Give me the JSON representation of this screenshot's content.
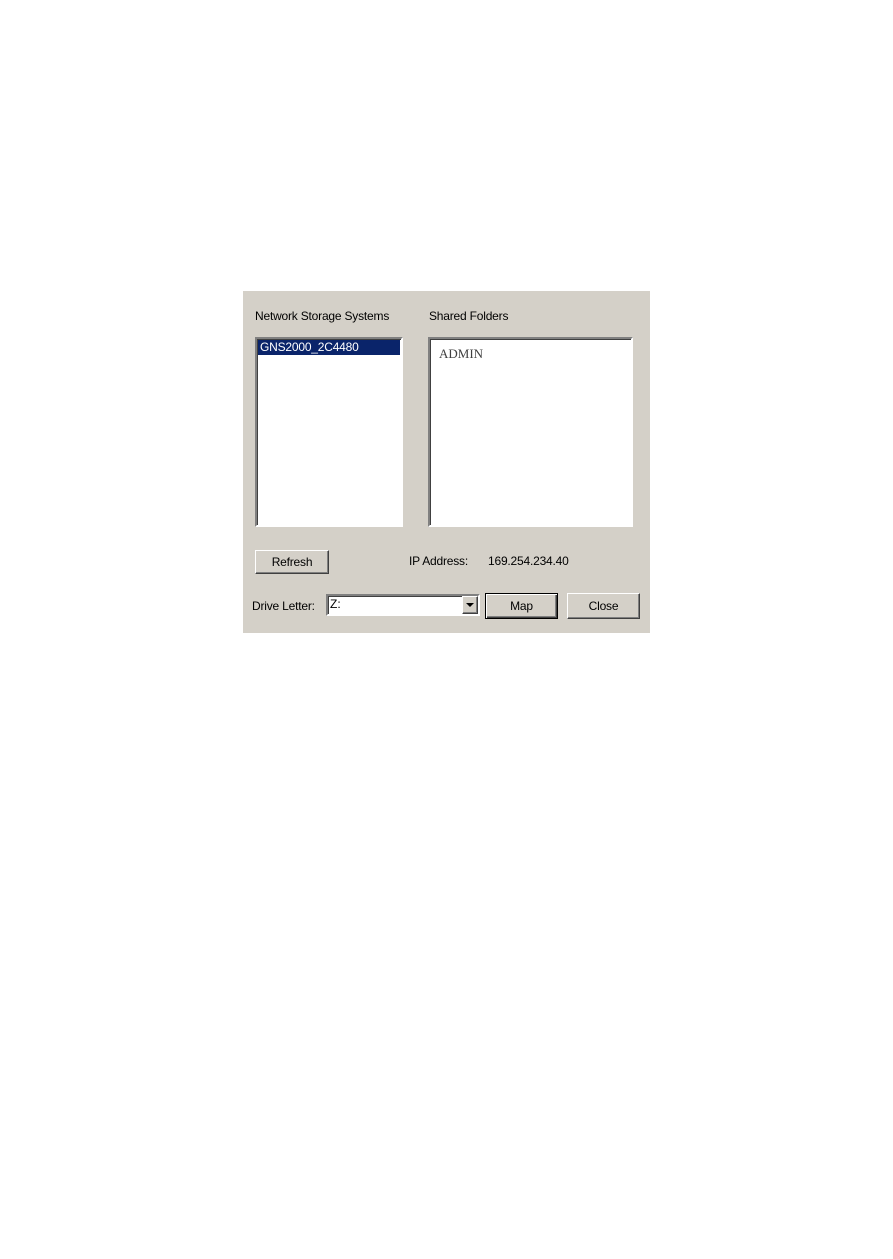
{
  "dialog": {
    "storage_label": "Network Storage Systems",
    "folders_label": "Shared Folders",
    "storage_items": [
      "GNS2000_2C4480"
    ],
    "folder_items": [
      "ADMIN"
    ],
    "refresh_label": "Refresh",
    "ip_label": "IP Address:",
    "ip_value": "169.254.234.40",
    "drive_label": "Drive Letter:",
    "drive_value": "Z:",
    "map_label": "Map",
    "close_label": "Close"
  },
  "colors": {
    "dialog_bg": "#d4d0c8",
    "selection_bg": "#0a246a",
    "selection_text": "#ffffff"
  },
  "icons": {
    "dropdown": "chevron-down-icon"
  }
}
